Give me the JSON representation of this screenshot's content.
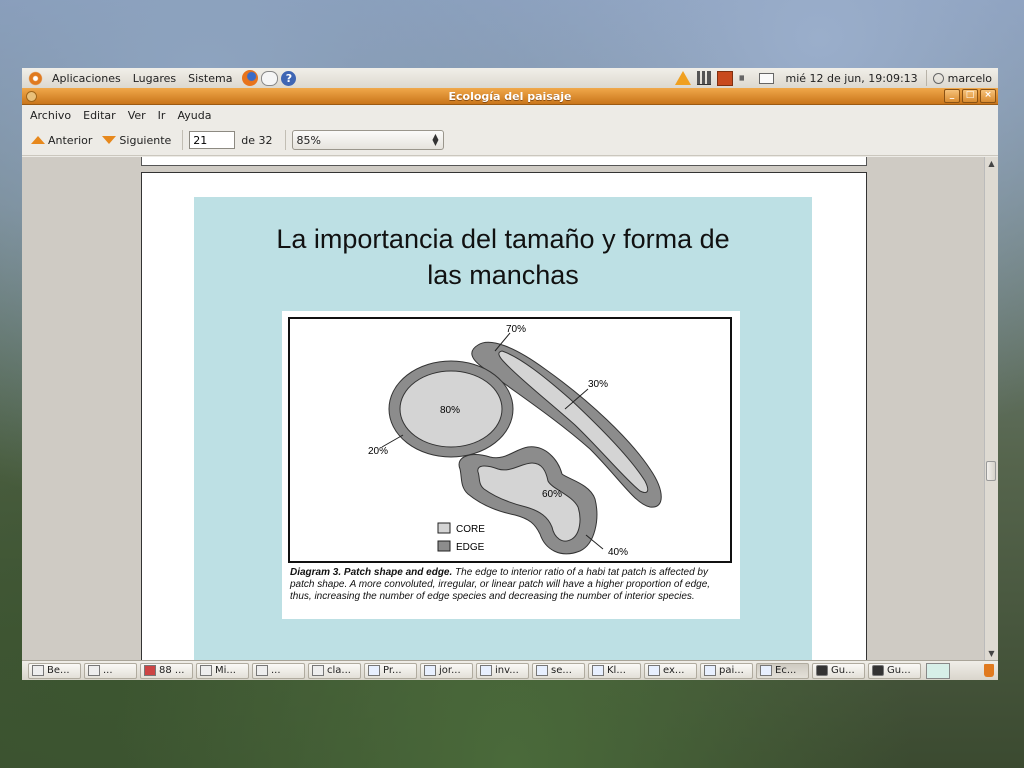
{
  "top_panel": {
    "menus": [
      "Aplicaciones",
      "Lugares",
      "Sistema"
    ],
    "clock": "mié 12 de jun, 19:09:13",
    "user": "marcelo"
  },
  "window": {
    "title": "Ecología del paisaje",
    "menu": [
      "Archivo",
      "Editar",
      "Ver",
      "Ir",
      "Ayuda"
    ],
    "toolbar": {
      "prev_label": "Anterior",
      "next_label": "Siguiente",
      "page_value": "21",
      "page_of": "de 32",
      "zoom": "85%"
    }
  },
  "slide": {
    "title_line1": "La importancia del tamaño y forma de",
    "title_line2": "las manchas",
    "diagram": {
      "labels": [
        "70%",
        "30%",
        "80%",
        "20%",
        "60%",
        "40%"
      ],
      "legend": [
        "CORE",
        "EDGE"
      ],
      "colors": {
        "core": "#d4d4d4",
        "edge": "#8c8c8c"
      }
    },
    "caption_bold": "Diagram 3. Patch shape and edge.",
    "caption_text": " The edge to interior ratio of a habi tat patch is affected by patch shape. A more convoluted, irregular, or linear patch will have a higher proportion of edge, thus, increasing the number of edge species and decreasing the number of interior species."
  },
  "taskbar": {
    "items": [
      "Be...",
      "...",
      "88 ...",
      "Mi...",
      "...",
      "cla...",
      "Pr...",
      "jor...",
      "inv...",
      "se...",
      "Kl...",
      "ex...",
      "pai...",
      "Ec...",
      "Gu...",
      "Gu..."
    ]
  }
}
